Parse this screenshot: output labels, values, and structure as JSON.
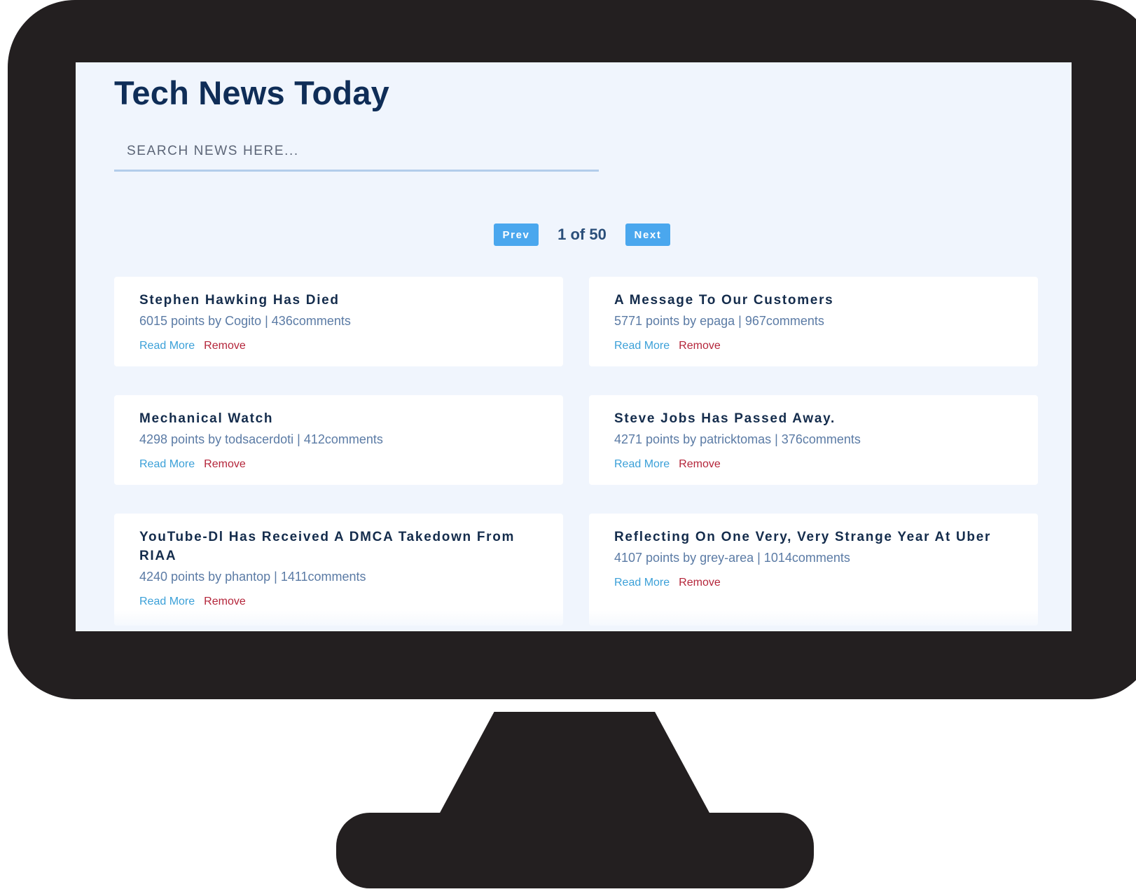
{
  "app": {
    "title": "Tech News Today"
  },
  "search": {
    "placeholder": "SEARCH NEWS HERE...",
    "value": ""
  },
  "pagination": {
    "prev_label": "Prev",
    "status": "1 of 50",
    "next_label": "Next",
    "current_page": 1,
    "total_pages": 50
  },
  "stories": [
    {
      "title": "Stephen Hawking Has Died",
      "meta": "6015 points by Cogito | 436comments",
      "read_more": "Read More",
      "remove": "Remove"
    },
    {
      "title": "A Message To Our Customers",
      "meta": "5771 points by epaga | 967comments",
      "read_more": "Read More",
      "remove": "Remove"
    },
    {
      "title": "Mechanical Watch",
      "meta": "4298 points by todsacerdoti | 412comments",
      "read_more": "Read More",
      "remove": "Remove"
    },
    {
      "title": "Steve Jobs Has Passed Away.",
      "meta": "4271 points by patricktomas | 376comments",
      "read_more": "Read More",
      "remove": "Remove"
    },
    {
      "title": "YouTube-Dl Has Received A DMCA Takedown From RIAA",
      "meta": "4240 points by phantop | 1411comments",
      "read_more": "Read More",
      "remove": "Remove"
    },
    {
      "title": "Reflecting On One Very, Very Strange Year At Uber",
      "meta": "4107 points by grey-area | 1014comments",
      "read_more": "Read More",
      "remove": "Remove"
    }
  ],
  "colors": {
    "monitor": "#231f20",
    "screen_background": "#f0f5fd",
    "title": "#0f2d57",
    "button": "#4aa7ee",
    "link": "#3ba0d8",
    "remove": "#b4253a"
  }
}
